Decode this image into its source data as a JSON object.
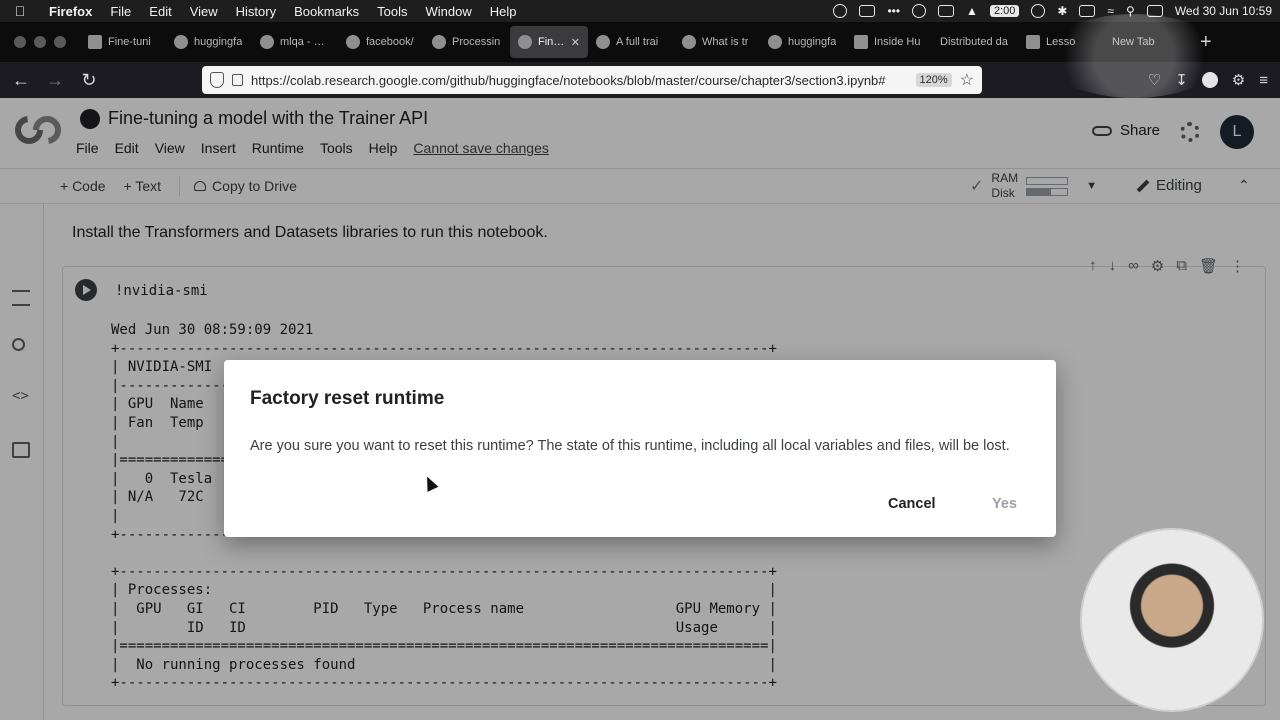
{
  "macbar": {
    "app": "Firefox",
    "menus": [
      "File",
      "Edit",
      "View",
      "History",
      "Bookmarks",
      "Tools",
      "Window",
      "Help"
    ],
    "timer": "2:00",
    "clock": "Wed 30 Jun  10:59"
  },
  "tabs": [
    {
      "label": "Fine-tuni"
    },
    {
      "label": "huggingfa"
    },
    {
      "label": "mlqa - Dat"
    },
    {
      "label": "facebook/"
    },
    {
      "label": "Processin"
    },
    {
      "label": "Fine-t",
      "active": true
    },
    {
      "label": "A full trai"
    },
    {
      "label": "What is tr"
    },
    {
      "label": "huggingfa"
    },
    {
      "label": "Inside Hu"
    },
    {
      "label": "Distributed da"
    },
    {
      "label": "Lesso"
    },
    {
      "label": "New Tab"
    }
  ],
  "browser": {
    "url": "https://colab.research.google.com/github/huggingface/notebooks/blob/master/course/chapter3/section3.ipynb#",
    "zoom": "120%"
  },
  "colab": {
    "title": "Fine-tuning a model with the Trainer API",
    "menus": [
      "File",
      "Edit",
      "View",
      "Insert",
      "Runtime",
      "Tools",
      "Help"
    ],
    "warning": "Cannot save changes",
    "share": "Share",
    "avatar_initial": "L",
    "toolbar": {
      "code": "+ Code",
      "text": "+ Text",
      "drive": "Copy to Drive",
      "ram": "RAM",
      "disk": "Disk",
      "editing": "Editing"
    },
    "text_cell": "Install the Transformers and Datasets libraries to run this notebook.",
    "code_cell": "!nvidia-smi",
    "output_lines": [
      "Wed Jun 30 08:59:09 2021",
      "+-----------------------------------------------------------------------------+",
      "| NVIDIA-SMI",
      "|-------------------------------",
      "| GPU  Name",
      "| Fan  Temp",
      "|",
      "|===============================",
      "|   0  Tesla",
      "| N/A   72C",
      "|",
      "+-------------------------------",
      "",
      "+-----------------------------------------------------------------------------+",
      "| Processes:                                                                  |",
      "|  GPU   GI   CI        PID   Type   Process name                  GPU Memory |",
      "|        ID   ID                                                   Usage      |",
      "|=============================================================================|",
      "|  No running processes found                                                 |",
      "+-----------------------------------------------------------------------------+"
    ]
  },
  "dialog": {
    "title": "Factory reset runtime",
    "message": "Are you sure you want to reset this runtime? The state of this runtime, including all local variables and files, will be lost.",
    "cancel": "Cancel",
    "yes": "Yes"
  }
}
